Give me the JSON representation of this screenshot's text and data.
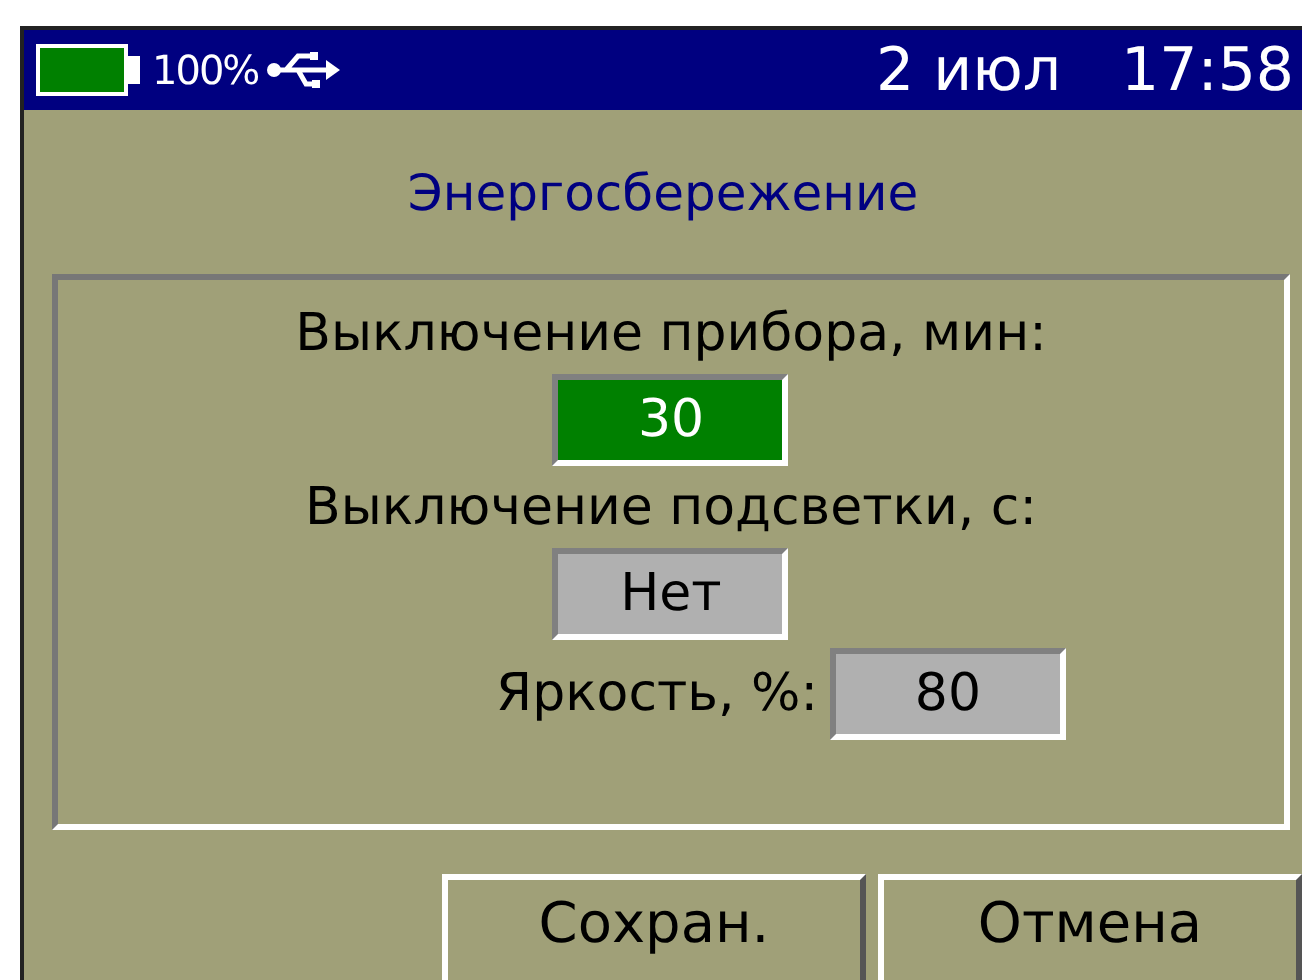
{
  "status_bar": {
    "battery": {
      "level": 1
    },
    "battery_text": "100%",
    "date": "2 июл",
    "time": "17:58"
  },
  "title": "Энергосбережение",
  "settings": [
    {
      "kind": "stacked",
      "label": "Выключение прибора, мин:",
      "value": "30",
      "selected": true
    },
    {
      "kind": "stacked",
      "label": "Выключение подсветки, с:",
      "value": "Нет",
      "selected": false
    },
    {
      "kind": "inline",
      "label": "Яркость, %:",
      "value": "80",
      "selected": false
    }
  ],
  "buttons": [
    "Сохран.",
    "Отмена"
  ]
}
